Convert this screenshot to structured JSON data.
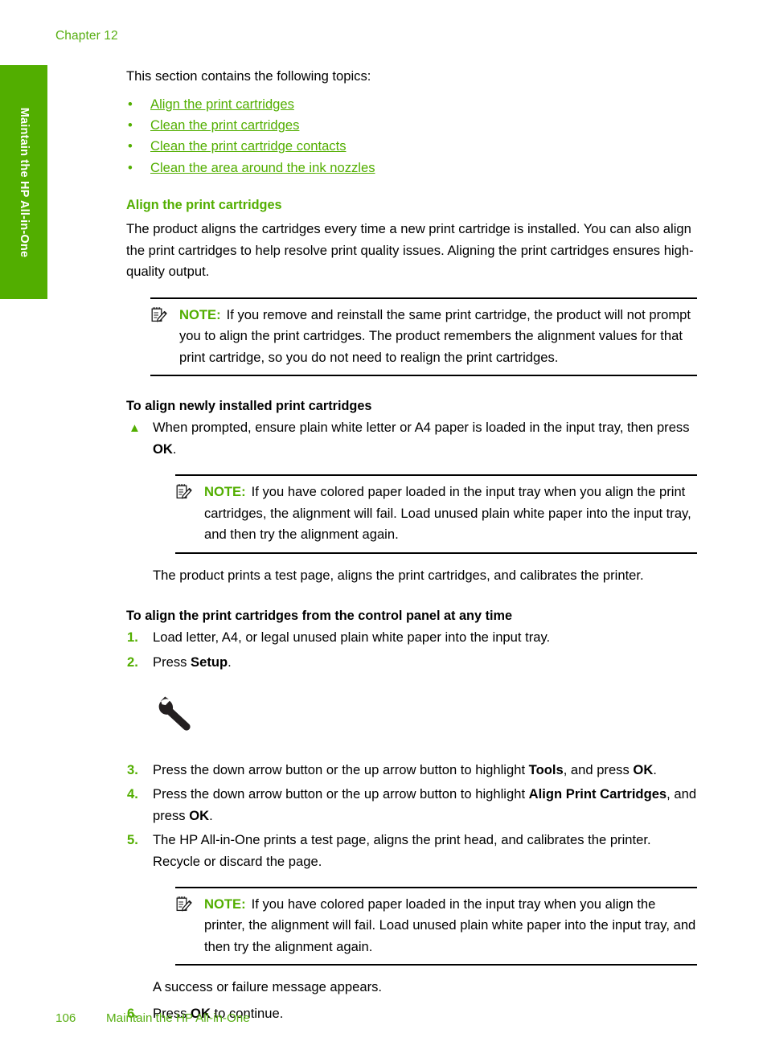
{
  "page": {
    "chapter_header": "Chapter 12",
    "side_tab_label": "Maintain the HP All-in-One",
    "footer": {
      "page_number": "106",
      "section_title": "Maintain the HP All-in-One"
    },
    "colors": {
      "brand_green": "#52ae00",
      "header_green": "#57ae12",
      "text_black": "#000000"
    }
  },
  "intro": {
    "text": "This section contains the following topics:"
  },
  "topic_links": [
    {
      "label": "Align the print cartridges",
      "bullet": "•"
    },
    {
      "label": "Clean the print cartridges",
      "bullet": "•"
    },
    {
      "label": "Clean the print cartridge contacts",
      "bullet": "•"
    },
    {
      "label": "Clean the area around the ink nozzles",
      "bullet": "•"
    }
  ],
  "section": {
    "heading": "Align the print cartridges",
    "paragraph": "The product aligns the cartridges every time a new print cartridge is installed. You can also align the print cartridges to help resolve print quality issues. Aligning the print cartridges ensures high-quality output."
  },
  "note_1": {
    "label": "NOTE:",
    "text": "If you remove and reinstall the same print cartridge, the product will not prompt you to align the print cartridges. The product remembers the alignment values for that print cartridge, so you do not need to realign the print cartridges."
  },
  "procedure_newly_installed": {
    "heading": "To align newly installed print cartridges",
    "marker": "▲",
    "step_prefix": "When prompted, ensure plain white letter or A4 paper is loaded in the input tray, then press ",
    "step_bold": "OK",
    "step_suffix": ".",
    "closing_paragraph": "The product prints a test page, aligns the print cartridges, and calibrates the printer."
  },
  "note_2": {
    "label": "NOTE:",
    "text": "If you have colored paper loaded in the input tray when you align the print cartridges, the alignment will fail. Load unused plain white paper into the input tray, and then try the alignment again."
  },
  "procedure_control_panel": {
    "heading": "To align the print cartridges from the control panel at any time",
    "steps": [
      {
        "number": "1.",
        "part_a": "Load letter, A4, or legal unused plain white paper into the input tray.",
        "bold": "",
        "part_b": ""
      },
      {
        "number": "2.",
        "part_a": "Press ",
        "bold": "Setup",
        "part_b": "."
      },
      {
        "number": "3.",
        "part_a": "Press the down arrow button or the up arrow button to highlight ",
        "bold": "Tools",
        "part_b": ", and press ",
        "bold2": "OK",
        "part_c": "."
      },
      {
        "number": "4.",
        "part_a": "Press the down arrow button or the up arrow button to highlight ",
        "bold": "Align Print Cartridges",
        "part_b": ", and press ",
        "bold2": "OK",
        "part_c": "."
      },
      {
        "number": "5.",
        "part_a": "The HP All-in-One prints a test page, aligns the print head, and calibrates the printer. Recycle or discard the page.",
        "bold": "",
        "part_b": ""
      },
      {
        "number": "6.",
        "part_a": "Press ",
        "bold": "OK",
        "part_b": " to continue."
      }
    ],
    "wrench_icon_name": "wrench-icon",
    "success_message": "A success or failure message appears."
  },
  "note_3": {
    "label": "NOTE:",
    "text": "If you have colored paper loaded in the input tray when you align the printer, the alignment will fail. Load unused plain white paper into the input tray, and then try the alignment again."
  },
  "icons": {
    "note_icon": "note-pencil-icon",
    "wrench": "wrench-icon"
  }
}
